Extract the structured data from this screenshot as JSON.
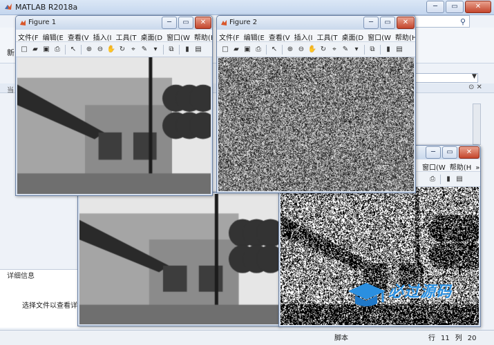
{
  "app": {
    "title": "MATLAB R2018a",
    "ribbon_fragment": "新",
    "panel_fragment": "当",
    "details_title": "详细信息",
    "details_text": "选择文件以查看详细",
    "status": {
      "mode": "脚本",
      "row_label": "行",
      "row": "11",
      "col_label": "列",
      "col": "20"
    }
  },
  "window_controls": {
    "minimize": "─",
    "restore": "▭",
    "close": "✕"
  },
  "figures": [
    {
      "title": "Figure 1",
      "menu": [
        "文件(F",
        "编辑(E",
        "查看(V",
        "插入(I",
        "工具(T",
        "桌面(D",
        "窗口(W",
        "帮助(H",
        "»"
      ]
    },
    {
      "title": "Figure 2",
      "menu": [
        "文件(F",
        "编辑(E",
        "查看(V",
        "插入(I",
        "工具(T",
        "桌面(D",
        "窗口(W",
        "帮助(H",
        "»"
      ]
    },
    {
      "title": "",
      "menu": []
    },
    {
      "title": "",
      "menu": [
        "窗口(W",
        "帮助(H",
        "»"
      ]
    }
  ],
  "watermark": {
    "text": "必过源码"
  },
  "colors": {
    "title_gradient_top": "#e8eff8",
    "title_gradient_bottom": "#c9d8ec",
    "close_red": "#c4452c",
    "watermark_blue": "#2a8fe0"
  }
}
